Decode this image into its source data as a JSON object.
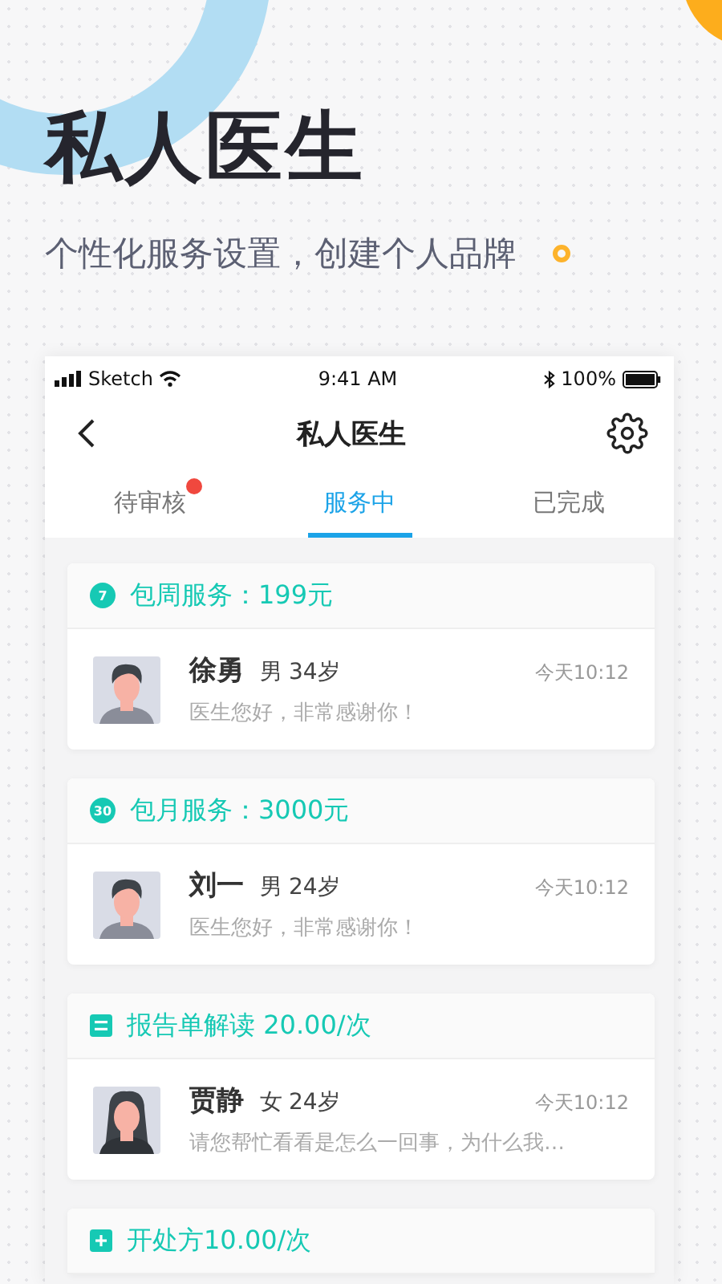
{
  "hero": {
    "title": "私人医生",
    "subtitle": "个性化服务设置，创建个人品牌"
  },
  "status_bar": {
    "carrier": "Sketch",
    "time": "9:41 AM",
    "battery": "100%"
  },
  "nav": {
    "title": "私人医生"
  },
  "tabs": [
    {
      "label": "待审核",
      "selected": false,
      "badge": true
    },
    {
      "label": "服务中",
      "selected": true,
      "badge": false
    },
    {
      "label": "已完成",
      "selected": false,
      "badge": false
    }
  ],
  "services": [
    {
      "kind": "number",
      "icon_text": "7",
      "title": "包周服务：199元",
      "patient": {
        "name": "徐勇",
        "gender": "男",
        "age": "34岁",
        "time": "今天10:12",
        "message": "医生您好，非常感谢你！",
        "kind": "male"
      }
    },
    {
      "kind": "number",
      "icon_text": "30",
      "title": "包月服务：3000元",
      "patient": {
        "name": "刘一",
        "gender": "男",
        "age": "24岁",
        "time": "今天10:12",
        "message": "医生您好，非常感谢你！",
        "kind": "male"
      }
    },
    {
      "kind": "report",
      "title": "报告单解读 20.00/次",
      "patient": {
        "name": "贾静",
        "gender": "女",
        "age": "24岁",
        "time": "今天10:12",
        "message": "请您帮忙看看是怎么一回事，为什么我…",
        "kind": "female"
      }
    },
    {
      "kind": "prescription",
      "title": "开处方10.00/次"
    }
  ]
}
